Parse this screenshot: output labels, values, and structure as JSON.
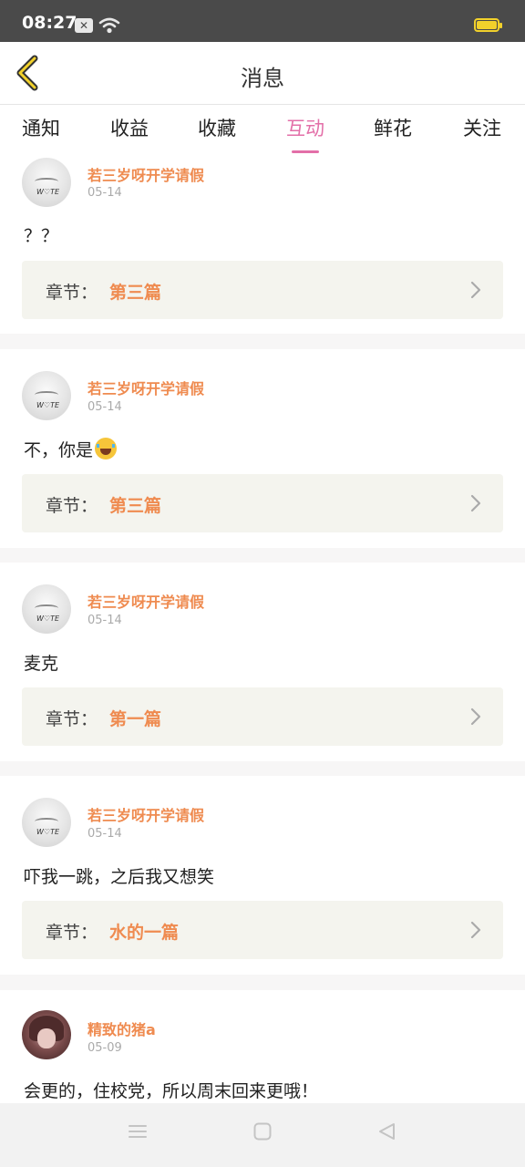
{
  "status_bar": {
    "time": "08:27",
    "sim_glyph": "✕"
  },
  "header": {
    "title": "消息",
    "back_icon": "chevron-left-icon"
  },
  "tabs": [
    {
      "label": "通知",
      "active": false
    },
    {
      "label": "收益",
      "active": false
    },
    {
      "label": "收藏",
      "active": false
    },
    {
      "label": "互动",
      "active": true
    },
    {
      "label": "鲜花",
      "active": false
    },
    {
      "label": "关注",
      "active": false
    }
  ],
  "chapter_label": "章节：",
  "messages": [
    {
      "user": "若三岁呀开学请假",
      "date": "05-14",
      "content": "？？",
      "chapter": "第三篇"
    },
    {
      "user": "若三岁呀开学请假",
      "date": "05-14",
      "content": "不，你是",
      "emoji": "laughing-crying-emoji",
      "chapter": "第三篇"
    },
    {
      "user": "若三岁呀开学请假",
      "date": "05-14",
      "content": "麦克",
      "chapter": "第一篇"
    },
    {
      "user": "若三岁呀开学请假",
      "date": "05-14",
      "content": "吓我一跳，之后我又想笑",
      "chapter": "水的一篇"
    },
    {
      "user": "精致的猪a",
      "date": "05-09",
      "content": "会更的，住校党，所以周末回来更哦！"
    }
  ],
  "avatar_signature": "W♡TE",
  "colors": {
    "accent_orange": "#ef8b50",
    "tab_active": "#e36fa8",
    "status_bar": "#4a4a4a",
    "battery": "#f2d12b"
  }
}
